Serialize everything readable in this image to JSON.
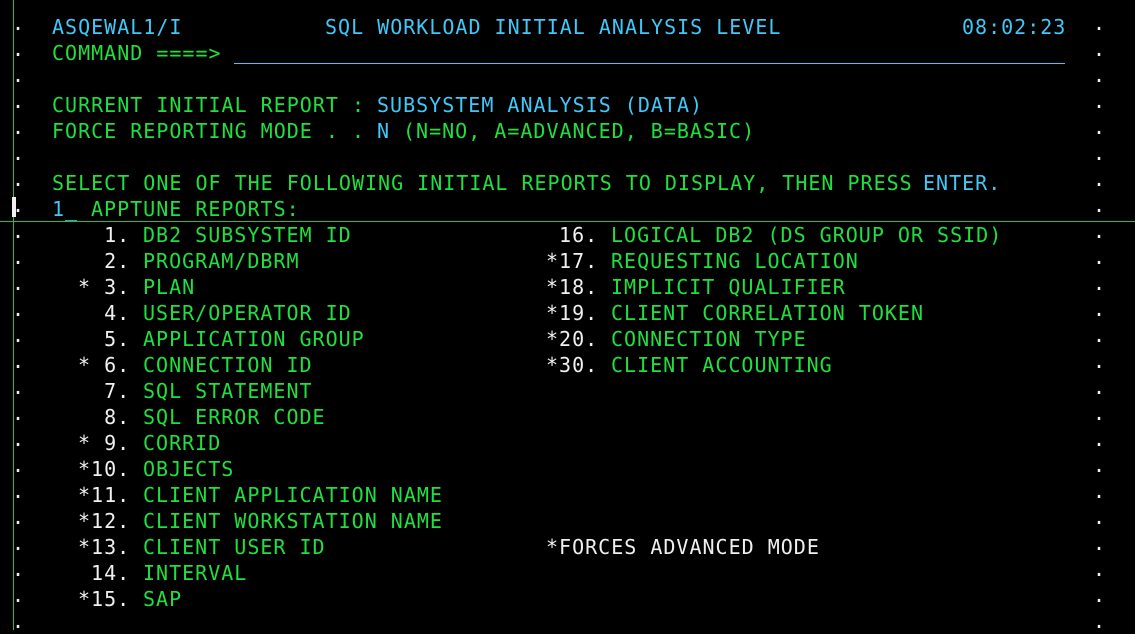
{
  "header": {
    "panel_id": "ASQEWAL1/I",
    "title": "SQL WORKLOAD INITIAL ANALYSIS LEVEL",
    "time": "08:02:23"
  },
  "command": {
    "label": "COMMAND ====>",
    "value": ""
  },
  "current_report": {
    "label": "CURRENT INITIAL REPORT :",
    "value": "SUBSYSTEM ANALYSIS (DATA)"
  },
  "force_mode": {
    "label": "FORCE REPORTING MODE . .",
    "value": "N",
    "options": "(N=NO, A=ADVANCED, B=BASIC)"
  },
  "instruction": {
    "text": "SELECT ONE OF THE FOLLOWING INITIAL REPORTS TO DISPLAY, THEN PRESS",
    "key": "ENTER."
  },
  "selection": {
    "value": "1_",
    "label": "APPTUNE REPORTS:"
  },
  "left_options": [
    {
      "num": "  1.",
      "label": "DB2 SUBSYSTEM ID"
    },
    {
      "num": "  2.",
      "label": "PROGRAM/DBRM"
    },
    {
      "num": "* 3.",
      "label": "PLAN"
    },
    {
      "num": "  4.",
      "label": "USER/OPERATOR ID"
    },
    {
      "num": "  5.",
      "label": "APPLICATION GROUP"
    },
    {
      "num": "* 6.",
      "label": "CONNECTION ID"
    },
    {
      "num": "  7.",
      "label": "SQL STATEMENT"
    },
    {
      "num": "  8.",
      "label": "SQL ERROR CODE"
    },
    {
      "num": "* 9.",
      "label": "CORRID"
    },
    {
      "num": "*10.",
      "label": "OBJECTS"
    },
    {
      "num": "*11.",
      "label": "CLIENT APPLICATION NAME"
    },
    {
      "num": "*12.",
      "label": "CLIENT WORKSTATION NAME"
    },
    {
      "num": "*13.",
      "label": "CLIENT USER ID"
    },
    {
      "num": " 14.",
      "label": "INTERVAL"
    },
    {
      "num": "*15.",
      "label": "SAP"
    }
  ],
  "right_options": [
    {
      "num": " 16.",
      "label": "LOGICAL DB2 (DS GROUP OR SSID)"
    },
    {
      "num": "*17.",
      "label": "REQUESTING LOCATION"
    },
    {
      "num": "*18.",
      "label": "IMPLICIT QUALIFIER"
    },
    {
      "num": "*19.",
      "label": "CLIENT CORRELATION TOKEN"
    },
    {
      "num": "*20.",
      "label": "CONNECTION TYPE"
    },
    {
      "num": "*30.",
      "label": "CLIENT ACCOUNTING"
    }
  ],
  "footnote": "*FORCES ADVANCED MODE",
  "colors": {
    "background": "#000000",
    "cyan": "#40c8f8",
    "green": "#20e040",
    "white": "#f0f0f0"
  }
}
